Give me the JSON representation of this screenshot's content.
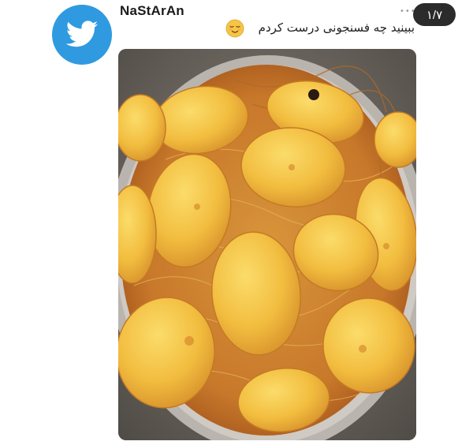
{
  "tweet": {
    "username": "NaStArAn",
    "text": "ببینید چه فسنجونی درست کردم",
    "emoji_icon": "relieved-face-icon",
    "more_icon": "more-dots-icon",
    "counter": "۱/۷"
  },
  "avatar": {
    "icon": "twitter-bird-icon",
    "color": "#2f9ae0"
  },
  "photo": {
    "subject": "tahdig-dish-photo"
  }
}
